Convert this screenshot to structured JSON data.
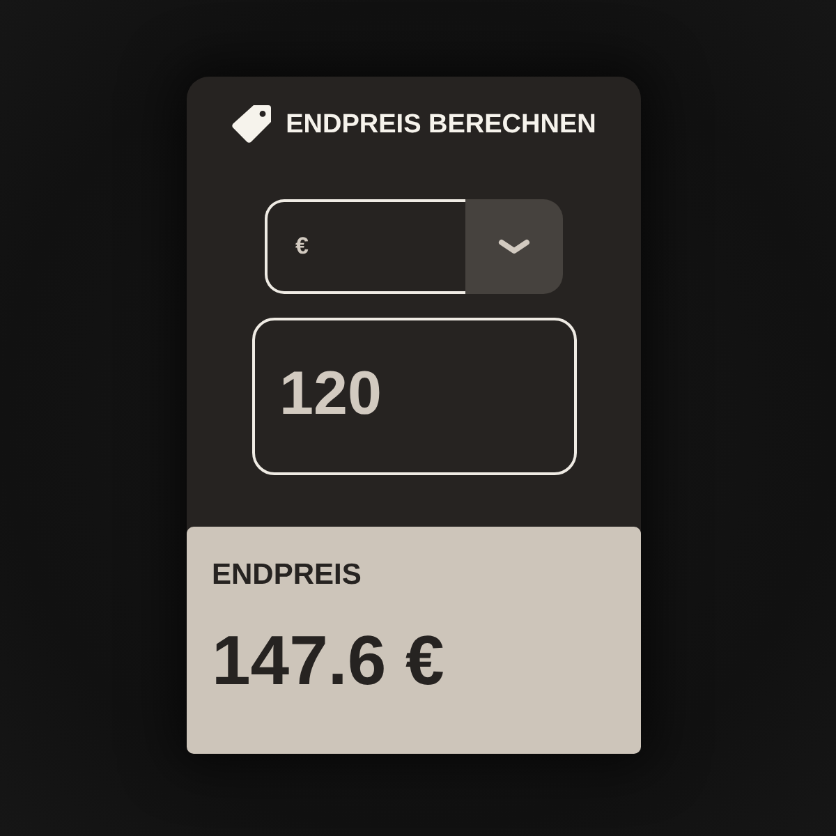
{
  "header": {
    "title": "ENDPREIS BERECHNEN"
  },
  "currency_select": {
    "value": "€"
  },
  "amount_field": {
    "value": "120"
  },
  "result": {
    "label": "ENDPREIS",
    "value": "147.6 €"
  }
}
